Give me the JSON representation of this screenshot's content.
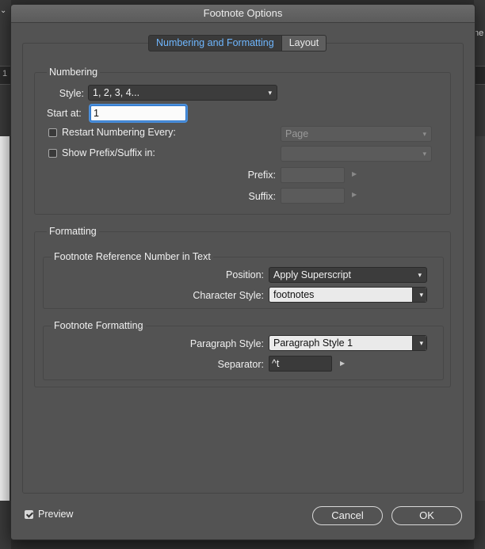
{
  "dialog": {
    "title": "Footnote Options"
  },
  "tabs": [
    {
      "label": "Numbering and Formatting",
      "active": true
    },
    {
      "label": "Layout",
      "active": false
    }
  ],
  "background": {
    "left_fragment": "1",
    "right_fragment": "ne"
  },
  "numbering": {
    "title": "Numbering",
    "style_label": "Style:",
    "style_value": "1, 2, 3, 4...",
    "start_label": "Start at:",
    "start_value": "1",
    "restart_label": "Restart Numbering Every:",
    "restart_checked": false,
    "restart_value": "Page",
    "prefix_suffix_label": "Show Prefix/Suffix in:",
    "prefix_suffix_checked": false,
    "prefix_suffix_value": "",
    "prefix_label": "Prefix:",
    "prefix_value": "",
    "suffix_label": "Suffix:",
    "suffix_value": ""
  },
  "formatting": {
    "title": "Formatting",
    "reference": {
      "title": "Footnote Reference Number in Text",
      "position_label": "Position:",
      "position_value": "Apply Superscript",
      "char_style_label": "Character Style:",
      "char_style_value": "footnotes"
    },
    "footnote": {
      "title": "Footnote Formatting",
      "para_style_label": "Paragraph Style:",
      "para_style_value": "Paragraph Style 1",
      "separator_label": "Separator:",
      "separator_value": "^t"
    }
  },
  "footer": {
    "preview_label": "Preview",
    "preview_checked": true,
    "cancel_label": "Cancel",
    "ok_label": "OK"
  },
  "colors": {
    "dialog_bg": "#535353",
    "active_tab_text": "#6fb7ff",
    "focus_ring": "#4a8fdc"
  },
  "icons": {
    "dropdown": "chevron-down-icon",
    "flyout": "triangle-right-icon",
    "check": "checkmark-icon"
  }
}
